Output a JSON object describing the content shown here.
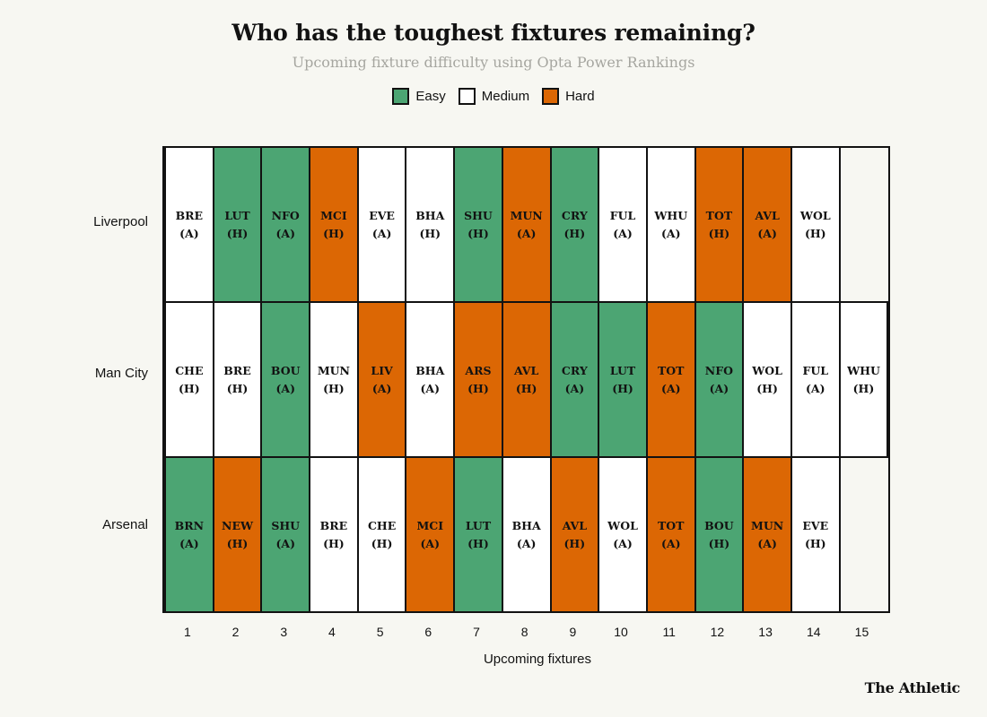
{
  "header": {
    "title": "Who has the toughest fixtures remaining?",
    "subtitle": "Upcoming fixture difficulty using Opta Power Rankings"
  },
  "legend": {
    "items": [
      {
        "label": "Easy",
        "color": "#4CA573",
        "icon": "green-square-swatch"
      },
      {
        "label": "Medium",
        "color": "#FFFFFF",
        "icon": "white-square-swatch"
      },
      {
        "label": "Hard",
        "color": "#DC6704",
        "icon": "orange-square-swatch"
      }
    ]
  },
  "axis": {
    "x_title": "Upcoming fixtures",
    "x_ticks": [
      "1",
      "2",
      "3",
      "4",
      "5",
      "6",
      "7",
      "8",
      "9",
      "10",
      "11",
      "12",
      "13",
      "14",
      "15"
    ]
  },
  "footer": {
    "logo": "The Athletic"
  },
  "colors": {
    "easy": "#4CA573",
    "medium": "#FFFFFF",
    "hard": "#DC6704",
    "background": "#F7F7F2",
    "ink": "#121212",
    "subtitle": "#A6A6A0"
  },
  "chart_data": {
    "type": "heatmap",
    "title": "Who has the toughest fixtures remaining?",
    "subtitle": "Upcoming fixture difficulty using Opta Power Rankings",
    "xlabel": "Upcoming fixtures",
    "ylabel": "",
    "grid": false,
    "legend_position": "top-center",
    "x": [
      "1",
      "2",
      "3",
      "4",
      "5",
      "6",
      "7",
      "8",
      "9",
      "10",
      "11",
      "12",
      "13",
      "14",
      "15"
    ],
    "categories": [
      "Easy",
      "Medium",
      "Hard"
    ],
    "category_colors": {
      "Easy": "#4CA573",
      "Medium": "#FFFFFF",
      "Hard": "#DC6704"
    },
    "rows": [
      {
        "team": "Liverpool",
        "fixture_count": 14,
        "cells": [
          {
            "index": 1,
            "opponent": "BRE",
            "venue": "(A)",
            "difficulty": "Medium"
          },
          {
            "index": 2,
            "opponent": "LUT",
            "venue": "(H)",
            "difficulty": "Easy"
          },
          {
            "index": 3,
            "opponent": "NFO",
            "venue": "(A)",
            "difficulty": "Easy"
          },
          {
            "index": 4,
            "opponent": "MCI",
            "venue": "(H)",
            "difficulty": "Hard"
          },
          {
            "index": 5,
            "opponent": "EVE",
            "venue": "(A)",
            "difficulty": "Medium"
          },
          {
            "index": 6,
            "opponent": "BHA",
            "venue": "(H)",
            "difficulty": "Medium"
          },
          {
            "index": 7,
            "opponent": "SHU",
            "venue": "(H)",
            "difficulty": "Easy"
          },
          {
            "index": 8,
            "opponent": "MUN",
            "venue": "(A)",
            "difficulty": "Hard"
          },
          {
            "index": 9,
            "opponent": "CRY",
            "venue": "(H)",
            "difficulty": "Easy"
          },
          {
            "index": 10,
            "opponent": "FUL",
            "venue": "(A)",
            "difficulty": "Medium"
          },
          {
            "index": 11,
            "opponent": "WHU",
            "venue": "(A)",
            "difficulty": "Medium"
          },
          {
            "index": 12,
            "opponent": "TOT",
            "venue": "(H)",
            "difficulty": "Hard"
          },
          {
            "index": 13,
            "opponent": "AVL",
            "venue": "(A)",
            "difficulty": "Hard"
          },
          {
            "index": 14,
            "opponent": "WOL",
            "venue": "(H)",
            "difficulty": "Medium"
          }
        ]
      },
      {
        "team": "Man City",
        "fixture_count": 15,
        "cells": [
          {
            "index": 1,
            "opponent": "CHE",
            "venue": "(H)",
            "difficulty": "Medium"
          },
          {
            "index": 2,
            "opponent": "BRE",
            "venue": "(H)",
            "difficulty": "Medium"
          },
          {
            "index": 3,
            "opponent": "BOU",
            "venue": "(A)",
            "difficulty": "Easy"
          },
          {
            "index": 4,
            "opponent": "MUN",
            "venue": "(H)",
            "difficulty": "Medium"
          },
          {
            "index": 5,
            "opponent": "LIV",
            "venue": "(A)",
            "difficulty": "Hard"
          },
          {
            "index": 6,
            "opponent": "BHA",
            "venue": "(A)",
            "difficulty": "Medium"
          },
          {
            "index": 7,
            "opponent": "ARS",
            "venue": "(H)",
            "difficulty": "Hard"
          },
          {
            "index": 8,
            "opponent": "AVL",
            "venue": "(H)",
            "difficulty": "Hard"
          },
          {
            "index": 9,
            "opponent": "CRY",
            "venue": "(A)",
            "difficulty": "Easy"
          },
          {
            "index": 10,
            "opponent": "LUT",
            "venue": "(H)",
            "difficulty": "Easy"
          },
          {
            "index": 11,
            "opponent": "TOT",
            "venue": "(A)",
            "difficulty": "Hard"
          },
          {
            "index": 12,
            "opponent": "NFO",
            "venue": "(A)",
            "difficulty": "Easy"
          },
          {
            "index": 13,
            "opponent": "WOL",
            "venue": "(H)",
            "difficulty": "Medium"
          },
          {
            "index": 14,
            "opponent": "FUL",
            "venue": "(A)",
            "difficulty": "Medium"
          },
          {
            "index": 15,
            "opponent": "WHU",
            "venue": "(H)",
            "difficulty": "Medium"
          }
        ]
      },
      {
        "team": "Arsenal",
        "fixture_count": 14,
        "cells": [
          {
            "index": 1,
            "opponent": "BRN",
            "venue": "(A)",
            "difficulty": "Easy"
          },
          {
            "index": 2,
            "opponent": "NEW",
            "venue": "(H)",
            "difficulty": "Hard"
          },
          {
            "index": 3,
            "opponent": "SHU",
            "venue": "(A)",
            "difficulty": "Easy"
          },
          {
            "index": 4,
            "opponent": "BRE",
            "venue": "(H)",
            "difficulty": "Medium"
          },
          {
            "index": 5,
            "opponent": "CHE",
            "venue": "(H)",
            "difficulty": "Medium"
          },
          {
            "index": 6,
            "opponent": "MCI",
            "venue": "(A)",
            "difficulty": "Hard"
          },
          {
            "index": 7,
            "opponent": "LUT",
            "venue": "(H)",
            "difficulty": "Easy"
          },
          {
            "index": 8,
            "opponent": "BHA",
            "venue": "(A)",
            "difficulty": "Medium"
          },
          {
            "index": 9,
            "opponent": "AVL",
            "venue": "(H)",
            "difficulty": "Hard"
          },
          {
            "index": 10,
            "opponent": "WOL",
            "venue": "(A)",
            "difficulty": "Medium"
          },
          {
            "index": 11,
            "opponent": "TOT",
            "venue": "(A)",
            "difficulty": "Hard"
          },
          {
            "index": 12,
            "opponent": "BOU",
            "venue": "(H)",
            "difficulty": "Easy"
          },
          {
            "index": 13,
            "opponent": "MUN",
            "venue": "(A)",
            "difficulty": "Hard"
          },
          {
            "index": 14,
            "opponent": "EVE",
            "venue": "(H)",
            "difficulty": "Medium"
          }
        ]
      }
    ]
  }
}
